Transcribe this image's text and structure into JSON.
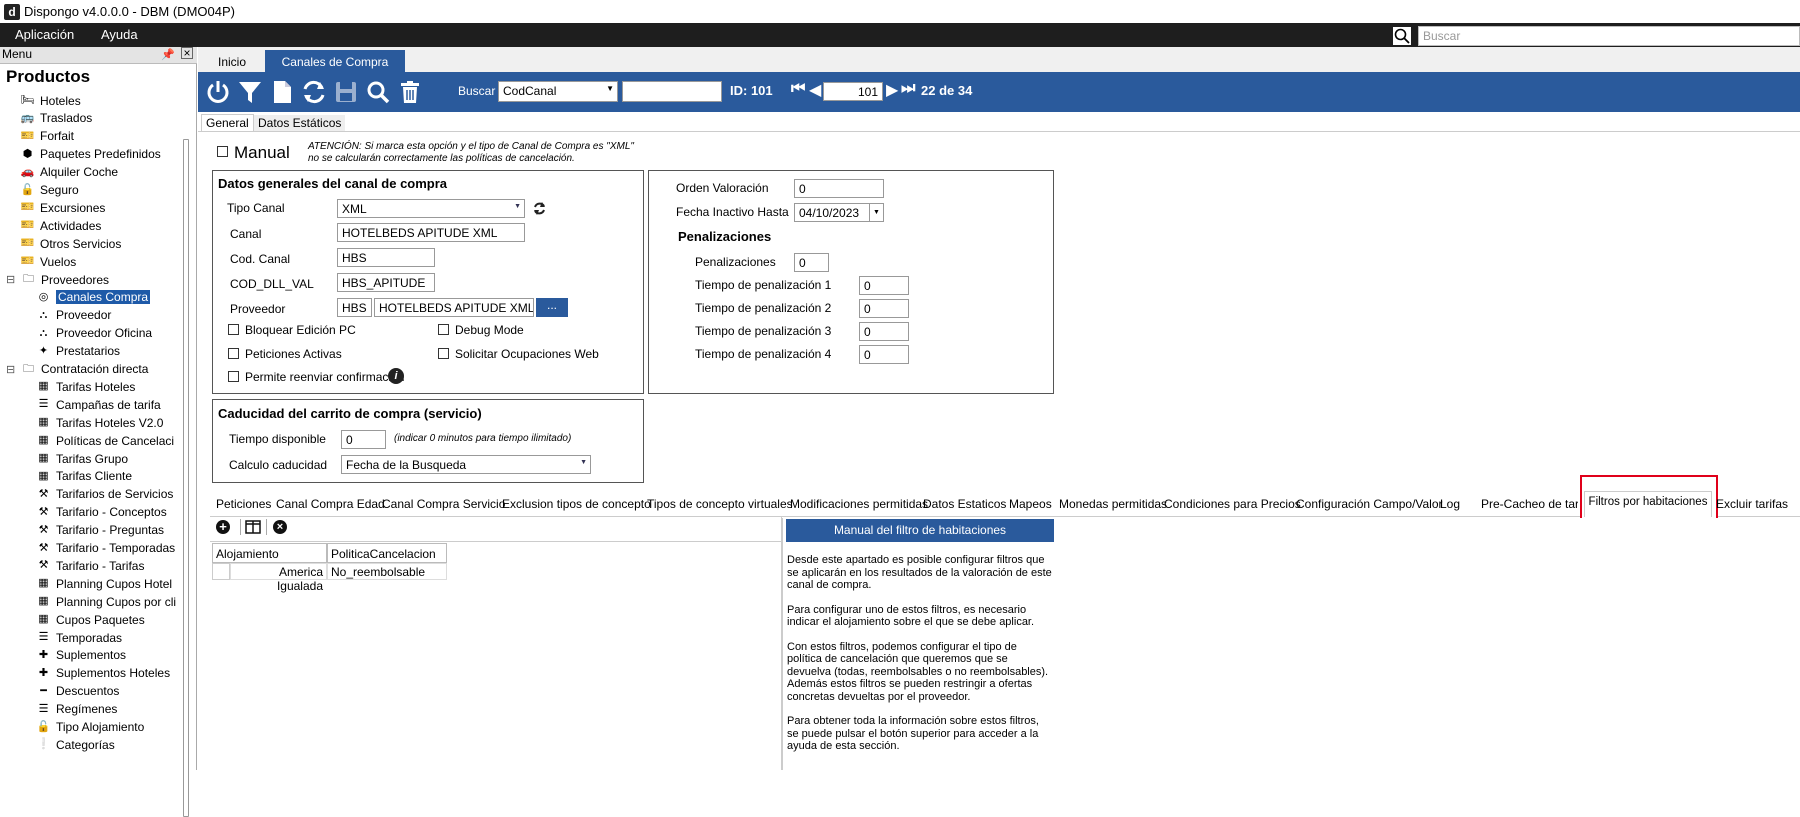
{
  "window": {
    "title": "Dispongo v4.0.0.0 - DBM (DMO04P)",
    "logo": "d"
  },
  "menubar": {
    "items": [
      "Aplicación",
      "Ayuda"
    ],
    "search_placeholder": "Buscar"
  },
  "leftpanel": {
    "header": "Menu",
    "title": "Productos",
    "items": [
      {
        "label": "Hoteles",
        "icon": "bed-icon"
      },
      {
        "label": "Traslados",
        "icon": "bus-icon"
      },
      {
        "label": "Forfait",
        "icon": "ticket-icon"
      },
      {
        "label": "Paquetes Predefinidos",
        "icon": "cubes-icon"
      },
      {
        "label": "Alquiler Coche",
        "icon": "car-icon"
      },
      {
        "label": "Seguro",
        "icon": "lock-icon"
      },
      {
        "label": "Excursiones",
        "icon": "ticket-icon"
      },
      {
        "label": "Actividades",
        "icon": "ticket-icon"
      },
      {
        "label": "Otros Servicios",
        "icon": "ticket-icon"
      },
      {
        "label": "Vuelos",
        "icon": "ticket-icon"
      },
      {
        "label": "Proveedores",
        "icon": "folder-icon"
      },
      {
        "label": "Canales Compra",
        "icon": "target-icon"
      },
      {
        "label": "Proveedor",
        "icon": "sitemap-icon"
      },
      {
        "label": "Proveedor Oficina",
        "icon": "sitemap-icon"
      },
      {
        "label": "Prestatarios",
        "icon": "puzzle-icon"
      },
      {
        "label": "Contratación directa",
        "icon": "folder-icon"
      },
      {
        "label": "Tarifas Hoteles",
        "icon": "calendar-icon"
      },
      {
        "label": "Campañas de tarifa",
        "icon": "list-icon"
      },
      {
        "label": "Tarifas Hoteles V2.0",
        "icon": "calendar-icon"
      },
      {
        "label": "Políticas de Cancelaci",
        "icon": "calendar-icon"
      },
      {
        "label": "Tarifas Grupo",
        "icon": "calendar-icon"
      },
      {
        "label": "Tarifas Cliente",
        "icon": "calendar-icon"
      },
      {
        "label": "Tarifarios de Servicios",
        "icon": "ruler-icon"
      },
      {
        "label": "Tarifario - Conceptos",
        "icon": "ruler-icon"
      },
      {
        "label": "Tarifario - Preguntas",
        "icon": "ruler-icon"
      },
      {
        "label": "Tarifario - Temporadas",
        "icon": "ruler-icon"
      },
      {
        "label": "Tarifario - Tarifas",
        "icon": "ruler-icon"
      },
      {
        "label": "Planning Cupos Hotel",
        "icon": "calendar-icon"
      },
      {
        "label": "Planning Cupos por cli",
        "icon": "calendar-icon"
      },
      {
        "label": "Cupos Paquetes",
        "icon": "calendar-icon"
      },
      {
        "label": "Temporadas",
        "icon": "list-icon"
      },
      {
        "label": "Suplementos",
        "icon": "plus-icon"
      },
      {
        "label": "Suplementos Hoteles",
        "icon": "plus-icon"
      },
      {
        "label": "Descuentos",
        "icon": "minus-icon"
      },
      {
        "label": "Regímenes",
        "icon": "list-icon"
      },
      {
        "label": "Tipo Alojamiento",
        "icon": "lock-icon"
      },
      {
        "label": "Categorías",
        "icon": "exclamation-icon"
      }
    ]
  },
  "toptabs": [
    "Inicio",
    "Canales de Compra"
  ],
  "toolbar": {
    "buscar_label": "Buscar",
    "search_field": "CodCanal",
    "search_value": "",
    "id_label": "ID: 101",
    "record_number": "101",
    "record_count": "22 de 34"
  },
  "subtabs": [
    "General",
    "Datos Estáticos"
  ],
  "manual": {
    "label": "Manual",
    "warning_line1": "ATENCIÓN: Si marca esta opción y el tipo de Canal de Compra es \"XML\"",
    "warning_line2": "no se calcularán correctamente las políticas de cancelación."
  },
  "general_panel": {
    "title": "Datos generales del canal de compra",
    "tipo_canal_label": "Tipo Canal",
    "tipo_canal_value": "XML",
    "canal_label": "Canal",
    "canal_value": "HOTELBEDS APITUDE XML",
    "cod_canal_label": "Cod. Canal",
    "cod_canal_value": "HBS",
    "cod_dll_label": "COD_DLL_VAL",
    "cod_dll_value": "HBS_APITUDE",
    "proveedor_label": "Proveedor",
    "proveedor_code": "HBS",
    "proveedor_name": "HOTELBEDS APITUDE XML",
    "proveedor_button": "...",
    "bloquear_label": "Bloquear Edición PC",
    "debug_label": "Debug Mode",
    "peticiones_label": "Peticiones Activas",
    "solicitar_label": "Solicitar Ocupaciones Web",
    "reenviar_label": "Permite reenviar confirmación"
  },
  "valoracion_panel": {
    "orden_label": "Orden Valoración",
    "orden_value": "0",
    "fecha_label": "Fecha Inactivo Hasta",
    "fecha_value": "04/10/2023",
    "penal_title": "Penalizaciones",
    "penal_label": "Penalizaciones",
    "penal_value": "0",
    "tiempos": [
      {
        "label": "Tiempo de penalización 1",
        "value": "0"
      },
      {
        "label": "Tiempo de penalización 2",
        "value": "0"
      },
      {
        "label": "Tiempo de penalización 3",
        "value": "0"
      },
      {
        "label": "Tiempo de penalización 4",
        "value": "0"
      }
    ]
  },
  "caducidad_panel": {
    "title": "Caducidad del carrito de compra (servicio)",
    "tiempo_label": "Tiempo disponible",
    "tiempo_value": "0",
    "tiempo_hint": "(indicar 0 minutos para tiempo ilimitado)",
    "calculo_label": "Calculo caducidad",
    "calculo_value": "Fecha de la Busqueda"
  },
  "bottomtabs": [
    "Peticiones",
    "Canal Compra Edad",
    "Canal Compra Servicio",
    "Exclusion tipos de concepto",
    "Tipos de concepto virtuales",
    "Modificaciones permitidas",
    "Datos Estaticos",
    "Mapeos",
    "Monedas permitidas",
    "Condiciones para Precios",
    "Configuración Campo/Valor",
    "Log",
    "Pre-Cacheo de tarifas",
    "Filtros por habitaciones",
    "Excluir tarifas"
  ],
  "grid": {
    "columns": [
      "Alojamiento",
      "PoliticaCancelacion"
    ],
    "rows": [
      [
        "America Igualada",
        "No_reembolsable"
      ]
    ]
  },
  "help": {
    "button": "Manual del filtro de habitaciones",
    "p1": [
      "Desde este apartado es posible configurar filtros que",
      "se aplicarán en los resultados de la valoración de este",
      "canal de compra."
    ],
    "p2": [
      "Para configurar uno de estos filtros, es necesario",
      "indicar el alojamiento sobre el que se debe aplicar."
    ],
    "p3": [
      "Con estos filtros, podemos configurar el tipo de",
      "política de cancelación que queremos que se",
      "devuelva (todas, reembolsables o no reembolsables).",
      "Además estos filtros se pueden restringir a ofertas",
      "concretas devueltas por el proveedor."
    ],
    "p4": [
      "Para obtener toda la información sobre estos filtros,",
      "se puede pulsar el botón superior para acceder a la",
      "ayuda de esta sección."
    ]
  },
  "colors": {
    "toolbar": "#2a5a9c",
    "selected": "#1e5aa8",
    "highlight": "#e0001a"
  }
}
